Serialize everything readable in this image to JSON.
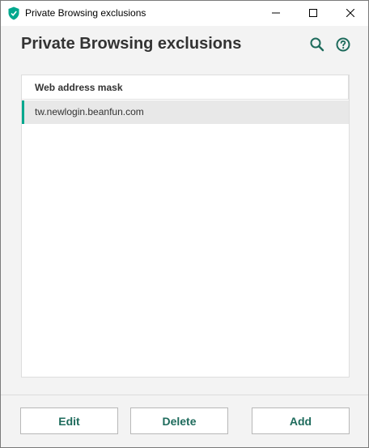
{
  "window": {
    "title": "Private Browsing exclusions",
    "app_icon": "kaspersky-shield-icon",
    "controls": [
      "minimize-icon",
      "maximize-icon",
      "close-icon"
    ]
  },
  "header": {
    "title": "Private Browsing exclusions",
    "icons": [
      "search-icon",
      "help-icon"
    ]
  },
  "list": {
    "columns": [
      "Web address mask"
    ],
    "rows": [
      {
        "mask": "tw.newlogin.beanfun.com",
        "selected": true
      }
    ]
  },
  "footer": {
    "edit_label": "Edit",
    "delete_label": "Delete",
    "add_label": "Add"
  },
  "colors": {
    "accent": "#00a88e",
    "button_text": "#1e6b5c",
    "selected_row": "#e8e8e8"
  }
}
